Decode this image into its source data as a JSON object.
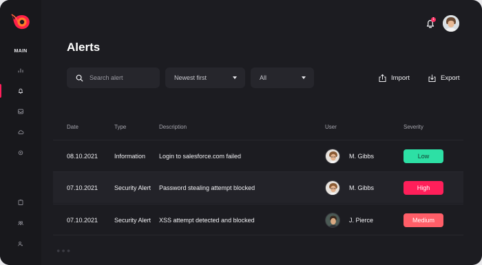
{
  "sidebar": {
    "section_label": "MAIN",
    "items": [
      {
        "icon": "bar-chart-icon"
      },
      {
        "icon": "alert-bell-icon",
        "active": true
      },
      {
        "icon": "inbox-icon"
      },
      {
        "icon": "cloud-icon"
      },
      {
        "icon": "settings-icon"
      },
      {
        "icon": "reports-icon"
      },
      {
        "icon": "team-icon"
      },
      {
        "icon": "user-settings-icon"
      }
    ]
  },
  "header": {
    "notification_count": "1",
    "title": "Alerts"
  },
  "filters": {
    "search_placeholder": "Search alert",
    "sort_value": "Newest first",
    "severity_value": "All",
    "import_label": "Import",
    "export_label": "Export"
  },
  "table": {
    "columns": [
      "Date",
      "Type",
      "Description",
      "User",
      "Severity"
    ],
    "rows": [
      {
        "date": "08.10.2021",
        "type": "Information",
        "description": "Login to salesforce.com failed",
        "user": "M. Gibbs",
        "severity": "Low",
        "severity_color": "#2de0a5",
        "severity_text": "#0f3b2d"
      },
      {
        "date": "07.10.2021",
        "type": "Security Alert",
        "description": "Password stealing attempt blocked",
        "user": "M. Gibbs",
        "severity": "High",
        "severity_color": "#ff1f5a",
        "severity_text": "#ffffff"
      },
      {
        "date": "07.10.2021",
        "type": "Security Alert",
        "description": "XSS attempt detected and blocked",
        "user": "J. Pierce",
        "severity": "Medium",
        "severity_color": "#ff5e68",
        "severity_text": "#ffffff"
      }
    ]
  },
  "colors": {
    "accent": "#ff1f5a",
    "background": "#1c1c21",
    "sidebar": "#18181c"
  }
}
